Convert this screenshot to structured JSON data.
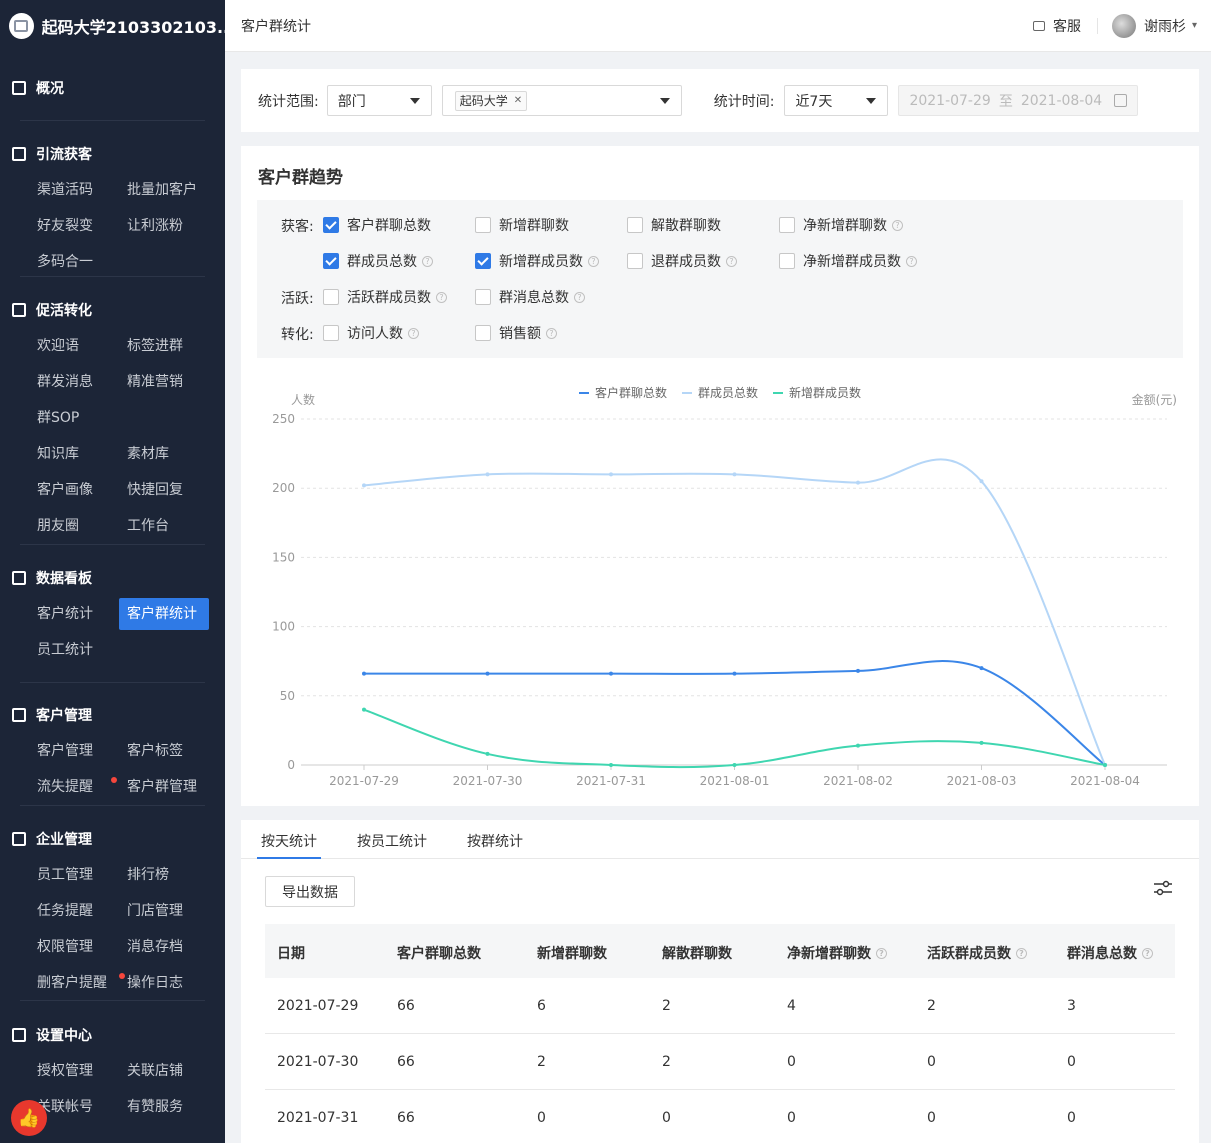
{
  "brand": {
    "title": "起码大学2103302103..."
  },
  "sidebar": {
    "sections": [
      {
        "title": "概况",
        "icon": "monitor-icon",
        "items": []
      },
      {
        "title": "引流获客",
        "icon": "store-icon",
        "items": [
          "渠道活码",
          "批量加客户",
          "好友裂变",
          "让利涨粉",
          "多码合一"
        ]
      },
      {
        "title": "促活转化",
        "icon": "clipboard-icon",
        "items": [
          "欢迎语",
          "标签进群",
          "群发消息",
          "精准营销",
          "群SOP",
          "",
          "知识库",
          "素材库",
          "客户画像",
          "快捷回复",
          "朋友圈",
          "工作台"
        ]
      },
      {
        "title": "数据看板",
        "icon": "monitor-icon",
        "items": [
          "客户统计",
          "客户群统计",
          "员工统计"
        ]
      },
      {
        "title": "客户管理",
        "icon": "user-icon",
        "items": [
          "客户管理",
          "客户标签",
          "流失提醒",
          "客户群管理"
        ]
      },
      {
        "title": "企业管理",
        "icon": "building-icon",
        "items": [
          "员工管理",
          "排行榜",
          "任务提醒",
          "门店管理",
          "权限管理",
          "消息存档",
          "删客户提醒",
          "操作日志"
        ]
      },
      {
        "title": "设置中心",
        "icon": "gear-icon",
        "items": [
          "授权管理",
          "关联店铺",
          "关联帐号",
          "有赞服务"
        ]
      }
    ],
    "active_item": "客户群统计"
  },
  "topbar": {
    "breadcrumb": "客户群统计",
    "service": "客服",
    "username": "谢雨杉"
  },
  "filter": {
    "scope_label": "统计范围:",
    "scope_value": "部门",
    "dept_tag": "起码大学",
    "time_label": "统计时间:",
    "time_value": "近7天",
    "date_start": "2021-07-29",
    "date_sep": "至",
    "date_end": "2021-08-04"
  },
  "trend": {
    "title": "客户群趋势",
    "groups": [
      {
        "label": "获客:",
        "options": [
          {
            "text": "客户群聊总数",
            "checked": true,
            "help": false
          },
          {
            "text": "新增群聊数",
            "checked": false,
            "help": false
          },
          {
            "text": "解散群聊数",
            "checked": false,
            "help": false
          },
          {
            "text": "净新增群聊数",
            "checked": false,
            "help": true
          }
        ]
      },
      {
        "label": "",
        "options": [
          {
            "text": "群成员总数",
            "checked": true,
            "help": true
          },
          {
            "text": "新增群成员数",
            "checked": true,
            "help": true
          },
          {
            "text": "退群成员数",
            "checked": false,
            "help": true
          },
          {
            "text": "净新增群成员数",
            "checked": false,
            "help": true
          }
        ]
      },
      {
        "label": "活跃:",
        "options": [
          {
            "text": "活跃群成员数",
            "checked": false,
            "help": true
          },
          {
            "text": "群消息总数",
            "checked": false,
            "help": true
          }
        ]
      },
      {
        "label": "转化:",
        "options": [
          {
            "text": "访问人数",
            "checked": false,
            "help": true
          },
          {
            "text": "销售额",
            "checked": false,
            "help": true
          }
        ]
      }
    ]
  },
  "chart_data": {
    "type": "line",
    "ylabel": "人数",
    "ylabel_right": "金额(元)",
    "ylim": [
      0,
      250
    ],
    "yticks": [
      0,
      50,
      100,
      150,
      200,
      250
    ],
    "x": [
      "2021-07-29",
      "2021-07-30",
      "2021-07-31",
      "2021-08-01",
      "2021-08-02",
      "2021-08-03",
      "2021-08-04"
    ],
    "legend_position": "top-center",
    "grid": true,
    "series": [
      {
        "name": "客户群聊总数",
        "color": "#3b86e8",
        "values": [
          66,
          66,
          66,
          66,
          68,
          70,
          0
        ]
      },
      {
        "name": "群成员总数",
        "color": "#b5d6f7",
        "values": [
          202,
          210,
          210,
          210,
          204,
          205,
          0
        ]
      },
      {
        "name": "新增群成员数",
        "color": "#3fd6b0",
        "values": [
          40,
          8,
          0,
          0,
          14,
          16,
          0
        ]
      }
    ]
  },
  "table": {
    "tabs": [
      "按天统计",
      "按员工统计",
      "按群统计"
    ],
    "active_tab": 0,
    "export_label": "导出数据",
    "columns": [
      {
        "label": "日期",
        "help": false
      },
      {
        "label": "客户群聊总数",
        "help": false
      },
      {
        "label": "新增群聊数",
        "help": false
      },
      {
        "label": "解散群聊数",
        "help": false
      },
      {
        "label": "净新增群聊数",
        "help": true
      },
      {
        "label": "活跃群成员数",
        "help": true
      },
      {
        "label": "群消息总数",
        "help": true
      }
    ],
    "rows": [
      [
        "2021-07-29",
        "66",
        "6",
        "2",
        "4",
        "2",
        "3"
      ],
      [
        "2021-07-30",
        "66",
        "2",
        "2",
        "0",
        "0",
        "0"
      ],
      [
        "2021-07-31",
        "66",
        "0",
        "0",
        "0",
        "0",
        "0"
      ]
    ]
  }
}
